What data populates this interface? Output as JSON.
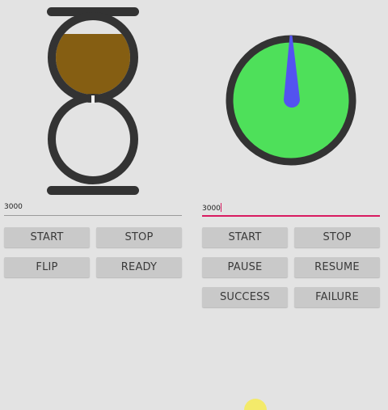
{
  "colors": {
    "background": "#e3e3e3",
    "frame": "#333333",
    "sand": "#855e12",
    "dial_face": "#4ee05a",
    "needle": "#5353f0",
    "accent_underline": "#d81b60",
    "button": "#c9c9c9"
  },
  "hourglass": {
    "field_value": "3000",
    "buttons": {
      "start": "START",
      "stop": "STOP",
      "flip": "FLIP",
      "ready": "READY"
    }
  },
  "timer": {
    "field_value": "3000",
    "buttons": {
      "start": "START",
      "stop": "STOP",
      "pause": "PAUSE",
      "resume": "RESUME",
      "success": "SUCCESS",
      "failure": "FAILURE"
    }
  }
}
